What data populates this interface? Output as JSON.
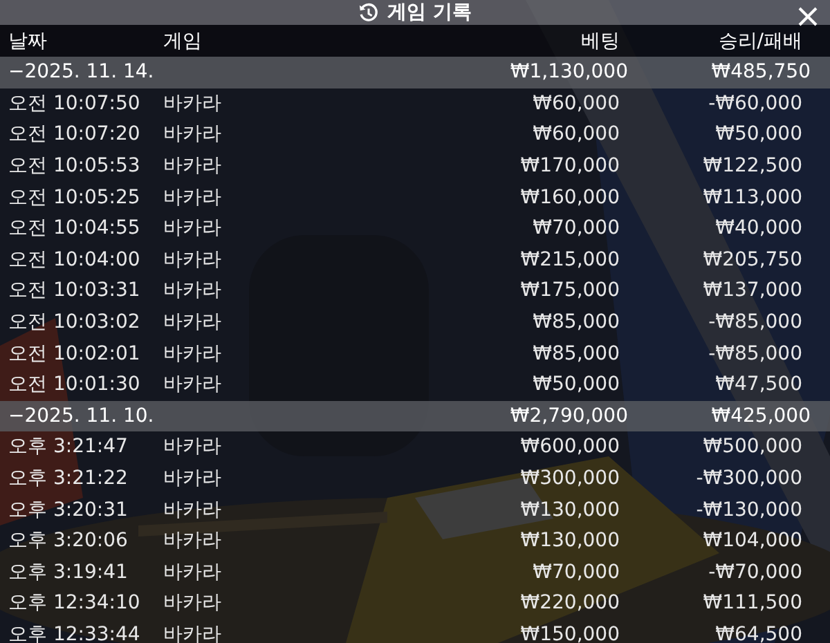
{
  "window": {
    "title": "게임 기록"
  },
  "table": {
    "columns": [
      "날짜",
      "게임",
      "베팅",
      "승리/패배"
    ],
    "groups": [
      {
        "date": "−2025. 11. 14.",
        "bet": "₩1,130,000",
        "result": "₩485,750",
        "expanded": true,
        "rows": [
          {
            "time": "오전 10:07:50",
            "game": "바카라",
            "bet": "₩60,000",
            "result": "-₩60,000"
          },
          {
            "time": "오전 10:07:20",
            "game": "바카라",
            "bet": "₩60,000",
            "result": "₩50,000"
          },
          {
            "time": "오전 10:05:53",
            "game": "바카라",
            "bet": "₩170,000",
            "result": "₩122,500"
          },
          {
            "time": "오전 10:05:25",
            "game": "바카라",
            "bet": "₩160,000",
            "result": "₩113,000"
          },
          {
            "time": "오전 10:04:55",
            "game": "바카라",
            "bet": "₩70,000",
            "result": "₩40,000"
          },
          {
            "time": "오전 10:04:00",
            "game": "바카라",
            "bet": "₩215,000",
            "result": "₩205,750"
          },
          {
            "time": "오전 10:03:31",
            "game": "바카라",
            "bet": "₩175,000",
            "result": "₩137,000"
          },
          {
            "time": "오전 10:03:02",
            "game": "바카라",
            "bet": "₩85,000",
            "result": "-₩85,000"
          },
          {
            "time": "오전 10:02:01",
            "game": "바카라",
            "bet": "₩85,000",
            "result": "-₩85,000"
          },
          {
            "time": "오전 10:01:30",
            "game": "바카라",
            "bet": "₩50,000",
            "result": "₩47,500"
          }
        ]
      },
      {
        "date": "−2025. 11. 10.",
        "bet": "₩2,790,000",
        "result": "₩425,000",
        "expanded": true,
        "rows": [
          {
            "time": "오후 3:21:47",
            "game": "바카라",
            "bet": "₩600,000",
            "result": "₩500,000"
          },
          {
            "time": "오후 3:21:22",
            "game": "바카라",
            "bet": "₩300,000",
            "result": "-₩300,000"
          },
          {
            "time": "오후 3:20:31",
            "game": "바카라",
            "bet": "₩130,000",
            "result": "-₩130,000"
          },
          {
            "time": "오후 3:20:06",
            "game": "바카라",
            "bet": "₩130,000",
            "result": "₩104,000"
          },
          {
            "time": "오후 3:19:41",
            "game": "바카라",
            "bet": "₩70,000",
            "result": "-₩70,000"
          },
          {
            "time": "오후 12:34:10",
            "game": "바카라",
            "bet": "₩220,000",
            "result": "₩111,500"
          },
          {
            "time": "오후 12:33:44",
            "game": "바카라",
            "bet": "₩150,000",
            "result": "₩64,500"
          }
        ]
      }
    ]
  }
}
